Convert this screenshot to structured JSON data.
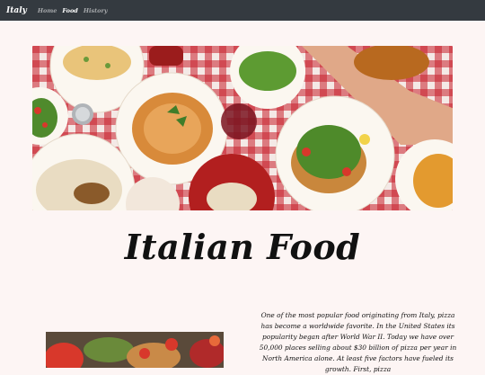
{
  "navbar": {
    "brand": "Italy",
    "links": [
      {
        "label": "Home",
        "active": false
      },
      {
        "label": "Food",
        "active": true
      },
      {
        "label": "History",
        "active": false
      }
    ]
  },
  "hero": {
    "alt": "Table with Italian dishes"
  },
  "page_title": "Italian Food",
  "article": {
    "text": "One of the most popular food originating from Italy, pizza has become a worldwide favorite. In the United States its popularity began after World War II. Today we have over 50,000 places selling about $30 billion of pizza per year in North America alone. At least five factors have fueled its growth. First, pizza"
  },
  "colors": {
    "navbar_bg": "#343a40",
    "page_bg": "#fdf5f4",
    "tablecloth_red": "#c8202b"
  }
}
